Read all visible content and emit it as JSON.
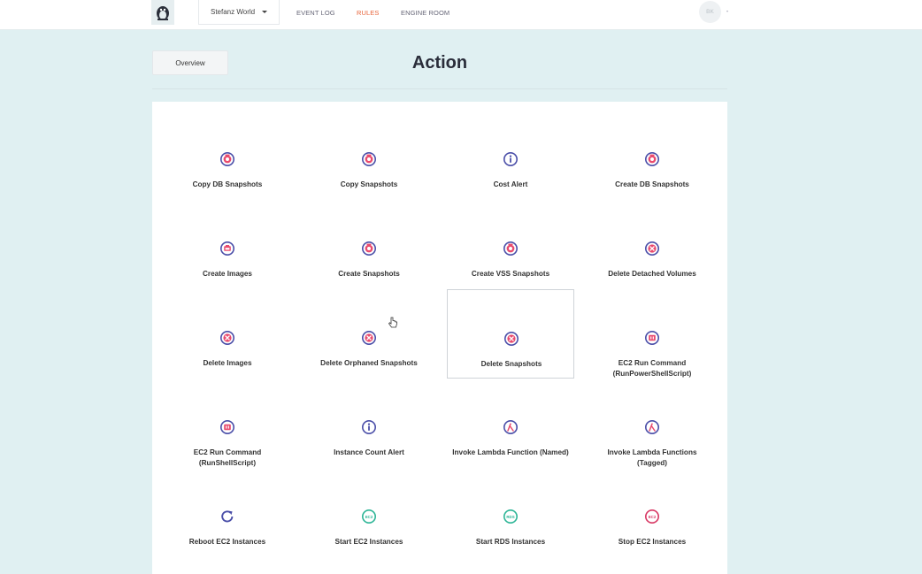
{
  "topbar": {
    "workspace": "Stefanz World",
    "nav": [
      "EVENT LOG",
      "RULES",
      "ENGINE ROOM"
    ],
    "avatar_initials": "BK",
    "active_color": "#e8663d"
  },
  "header": {
    "overview_label": "Overview",
    "title": "Action"
  },
  "actions": [
    {
      "label": "Copy DB Snapshots",
      "icon": "snapshot-icon"
    },
    {
      "label": "Copy Snapshots",
      "icon": "snapshot-icon"
    },
    {
      "label": "Cost Alert",
      "icon": "info-icon"
    },
    {
      "label": "Create DB Snapshots",
      "icon": "snapshot-icon"
    },
    {
      "label": "Create Images",
      "icon": "image-icon"
    },
    {
      "label": "Create Snapshots",
      "icon": "snapshot-icon"
    },
    {
      "label": "Create VSS Snapshots",
      "icon": "snapshot-icon"
    },
    {
      "label": "Delete Detached Volumes",
      "icon": "delete-icon"
    },
    {
      "label": "Delete Images",
      "icon": "delete-icon"
    },
    {
      "label": "Delete Orphaned Snapshots",
      "icon": "delete-icon"
    },
    {
      "label": "Delete Snapshots",
      "icon": "delete-icon",
      "selected": true
    },
    {
      "label": "EC2 Run Command",
      "label2": "(RunPowerShellScript)",
      "icon": "run-command-icon"
    },
    {
      "label": "EC2 Run Command",
      "label2": "(RunShellScript)",
      "icon": "run-command-icon"
    },
    {
      "label": "Instance Count Alert",
      "icon": "info-icon"
    },
    {
      "label": "Invoke Lambda Function (Named)",
      "icon": "lambda-icon"
    },
    {
      "label": "Invoke Lambda Functions",
      "label2": "(Tagged)",
      "icon": "lambda-icon"
    },
    {
      "label": "Reboot EC2 Instances",
      "icon": "reboot-icon"
    },
    {
      "label": "Start EC2 Instances",
      "icon": "ec2-start-icon",
      "badge": "EC2"
    },
    {
      "label": "Start RDS Instances",
      "icon": "rds-start-icon",
      "badge": "RDS"
    },
    {
      "label": "Stop EC2 Instances",
      "icon": "ec2-stop-icon",
      "badge": "EC2"
    }
  ]
}
